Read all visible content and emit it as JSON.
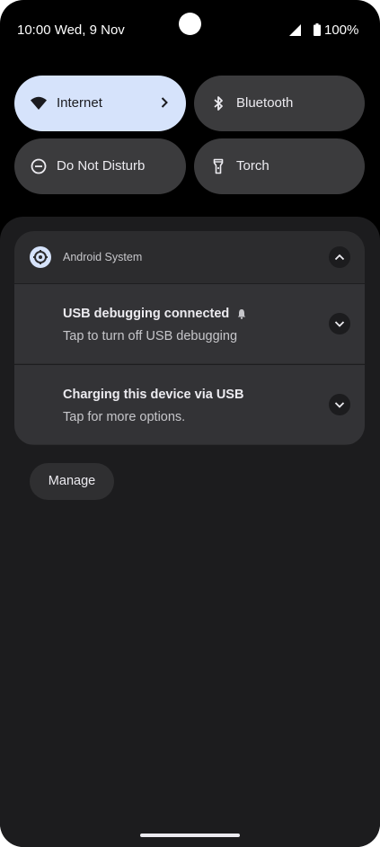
{
  "status_bar": {
    "time_date": "10:00 Wed, 9 Nov",
    "battery": "100%"
  },
  "quick_settings": [
    {
      "label": "Internet",
      "icon": "wifi-icon",
      "active": true
    },
    {
      "label": "Bluetooth",
      "icon": "bluetooth-icon",
      "active": false
    },
    {
      "label": "Do Not Disturb",
      "icon": "do-not-disturb-icon",
      "active": false
    },
    {
      "label": "Torch",
      "icon": "torch-icon",
      "active": false
    }
  ],
  "notification_group": {
    "app_name": "Android System",
    "app_icon": "settings-gear-icon",
    "notifications": [
      {
        "title": "USB debugging connected",
        "text": "Tap to turn off USB debugging",
        "badge_icon": "bell-icon"
      },
      {
        "title": "Charging this device via USB",
        "text": "Tap for more options."
      }
    ]
  },
  "manage_label": "Manage",
  "colors": {
    "background": "#000000",
    "tile": "#3b3b3d",
    "tile_active": "#d6e3fb",
    "shade": "#1c1c1e",
    "card": "#2c2c2e"
  }
}
